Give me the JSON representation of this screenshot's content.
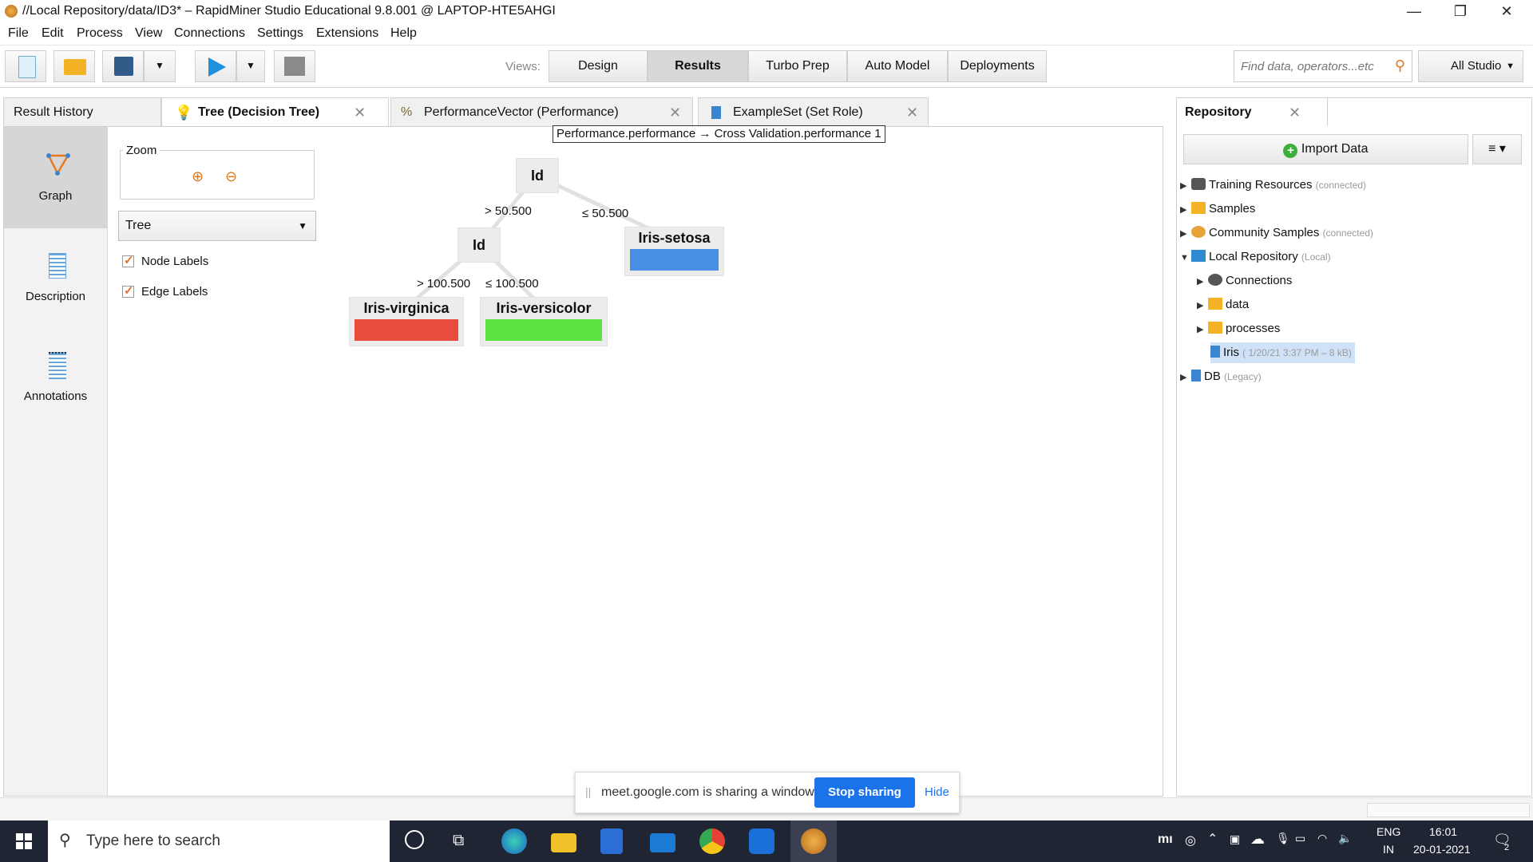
{
  "window": {
    "title": "//Local Repository/data/ID3* – RapidMiner Studio Educational 9.8.001 @ LAPTOP-HTE5AHGI",
    "minimize": "—",
    "maximize": "❐",
    "close": "✕"
  },
  "menu": [
    "File",
    "Edit",
    "Process",
    "View",
    "Connections",
    "Settings",
    "Extensions",
    "Help"
  ],
  "toolbar": {
    "views_label": "Views:",
    "views": [
      "Design",
      "Results",
      "Turbo Prep",
      "Auto Model",
      "Deployments"
    ],
    "active_view": "Results",
    "search_placeholder": "Find data, operators...etc",
    "scope": "All Studio"
  },
  "tabs": [
    {
      "label": "Result History"
    },
    {
      "label": "Tree (Decision Tree)",
      "active": true
    },
    {
      "label": "PerformanceVector (Performance)"
    },
    {
      "label": "ExampleSet (Set Role)"
    }
  ],
  "tooltip": "Performance.performance → Cross Validation.performance 1",
  "sidebar": {
    "items": [
      {
        "label": "Graph",
        "icon": "graph-icon",
        "active": true
      },
      {
        "label": "Description",
        "icon": "description-icon"
      },
      {
        "label": "Annotations",
        "icon": "annotations-icon"
      }
    ]
  },
  "controls": {
    "zoom_label": "Zoom",
    "layout_value": "Tree",
    "node_labels": "Node Labels",
    "edge_labels": "Edge Labels"
  },
  "tree": {
    "root": "Id",
    "root_left_edge": "> 50.500",
    "root_right_edge": "≤ 50.500",
    "inner": "Id",
    "inner_left_edge": "> 100.500",
    "inner_right_edge": "≤ 100.500",
    "leaves": [
      {
        "label": "Iris-virginica",
        "color": "#e84c3d"
      },
      {
        "label": "Iris-versicolor",
        "color": "#5ce540"
      },
      {
        "label": "Iris-setosa",
        "color": "#4a8fe6"
      }
    ]
  },
  "repository": {
    "tab": "Repository",
    "import_label": "Import Data",
    "menu_label": "≡ ▾",
    "items": [
      {
        "label": "Training Resources",
        "sub": "(connected)"
      },
      {
        "label": "Samples",
        "sub": ""
      },
      {
        "label": "Community Samples",
        "sub": "(connected)"
      },
      {
        "label": "Local Repository",
        "sub": "(Local)"
      },
      {
        "label": "Connections",
        "sub": ""
      },
      {
        "label": "data",
        "sub": ""
      },
      {
        "label": "processes",
        "sub": ""
      },
      {
        "label": "Iris",
        "sub": "( 1/20/21 3:37 PM – 8 kB)"
      },
      {
        "label": "DB",
        "sub": "(Legacy)"
      }
    ]
  },
  "share": {
    "text": "meet.google.com is sharing a window.",
    "stop": "Stop sharing",
    "hide": "Hide"
  },
  "taskbar": {
    "search_placeholder": "Type here to search",
    "lang": "ENG",
    "region": "IN",
    "time": "16:01",
    "date": "20-01-2021",
    "notifications": "2"
  }
}
